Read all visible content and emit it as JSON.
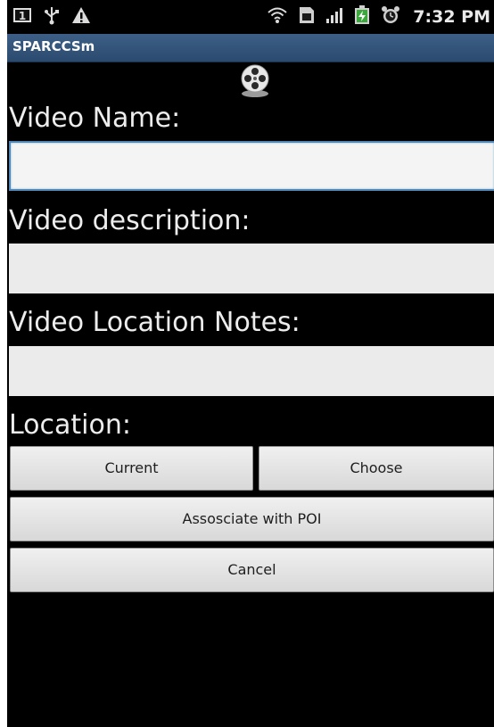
{
  "status_bar": {
    "notification_icons": [
      "sim-card-icon",
      "usb-icon",
      "warning-icon"
    ],
    "system_icons": [
      "wifi-icon",
      "sd-card-icon",
      "signal-icon",
      "battery-charging-icon",
      "alarm-clock-icon"
    ],
    "time": "7:32 PM"
  },
  "app": {
    "title": "SPARCCSm",
    "header_icon": "film-reel-icon"
  },
  "form": {
    "video_name": {
      "label": "Video Name:",
      "value": "",
      "placeholder": ""
    },
    "video_description": {
      "label": "Video description:",
      "value": "",
      "placeholder": ""
    },
    "video_location_notes": {
      "label": "Video Location Notes:",
      "value": "",
      "placeholder": ""
    },
    "location_label": "Location:",
    "buttons": {
      "current": "Current",
      "choose": "Choose",
      "associate_poi": "Assosciate with POI",
      "cancel": "Cancel"
    }
  },
  "colors": {
    "background": "#000000",
    "title_bar": "#35577e",
    "input_focus_border": "#4f86b5",
    "input_bg": "#ebebeb",
    "button_bg": "#e4e4e4"
  }
}
